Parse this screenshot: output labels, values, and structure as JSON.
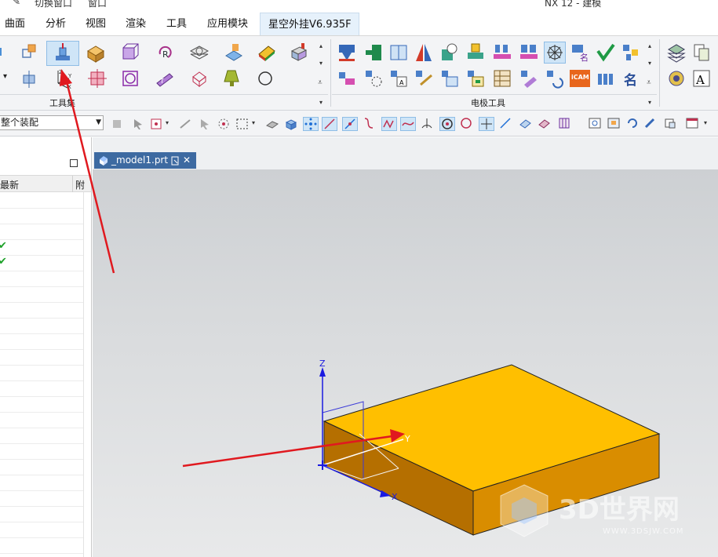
{
  "titlebar": {
    "switch_window": "切换窗口",
    "window_menu": "窗口",
    "app_title": "NX 12 - 建模"
  },
  "menu": {
    "tabs": [
      {
        "label": "曲面"
      },
      {
        "label": "分析"
      },
      {
        "label": "视图"
      },
      {
        "label": "渲染"
      },
      {
        "label": "工具"
      },
      {
        "label": "应用模块"
      },
      {
        "label": "星空外挂V6.935F"
      }
    ],
    "active_tab": "星空外挂V6.935F"
  },
  "ribbon": {
    "groups": [
      {
        "label": "工具集"
      },
      {
        "label": "电极工具"
      }
    ],
    "tools_row1": [
      "csys-icon",
      "wcs-origin-icon",
      "box-block-icon",
      "box-bound-icon",
      "rotate-icon",
      "layer-icon",
      "paint-face-icon",
      "color-icon",
      "part-icon"
    ],
    "tools_row2": [
      "move-icon",
      "csys-xyz-icon",
      "point-icon",
      "circle-icon",
      "text-icon",
      "erase-icon",
      "lamp-icon",
      "ring-icon"
    ],
    "electrode_row1": [
      "electrode-add-icon",
      "electrode-base-icon",
      "electrode-book-icon",
      "electrode-mirror-icon",
      "electrode-spark-icon",
      "electrode-holder-icon",
      "electrode-multi-icon",
      "electrode-pair-icon",
      "electrode-star-icon",
      "electrode-name-icon",
      "electrode-check-icon",
      "electrode-assembly-icon"
    ],
    "electrode_row2": [
      "electrode-sheet-icon",
      "electrode-gear-icon",
      "electrode-paper-icon",
      "electrode-tools-icon",
      "electrode-table-icon",
      "electrode-rank-icon",
      "electrode-grid-icon",
      "electrode-text-icon",
      "electrode-rotate-icon",
      "icam-icon",
      "electrode-group-icon"
    ],
    "icam_label": "iCAM",
    "name_glyph": "名"
  },
  "filterbar": {
    "selection_scope": "整个装配"
  },
  "navigator": {
    "header_col1": "最新",
    "header_col2": "附",
    "checkmarks": [
      "✔",
      "✔"
    ]
  },
  "viewport": {
    "tab_label": "_model1.prt",
    "axes": {
      "z": "Z",
      "y": "Y",
      "x": "X"
    }
  },
  "colors": {
    "accent": "#3d6aa1",
    "block_top": "#ffbf00",
    "block_side": "#d98d00",
    "block_front": "#b56f00",
    "annotation_arrow": "#e0191f",
    "ribbon_bg": "#f3f4f6",
    "selected_tool": "#cfe5f7"
  },
  "watermark": {
    "brand": "3D世界网",
    "url": "WWW.3DSJW.COM"
  }
}
